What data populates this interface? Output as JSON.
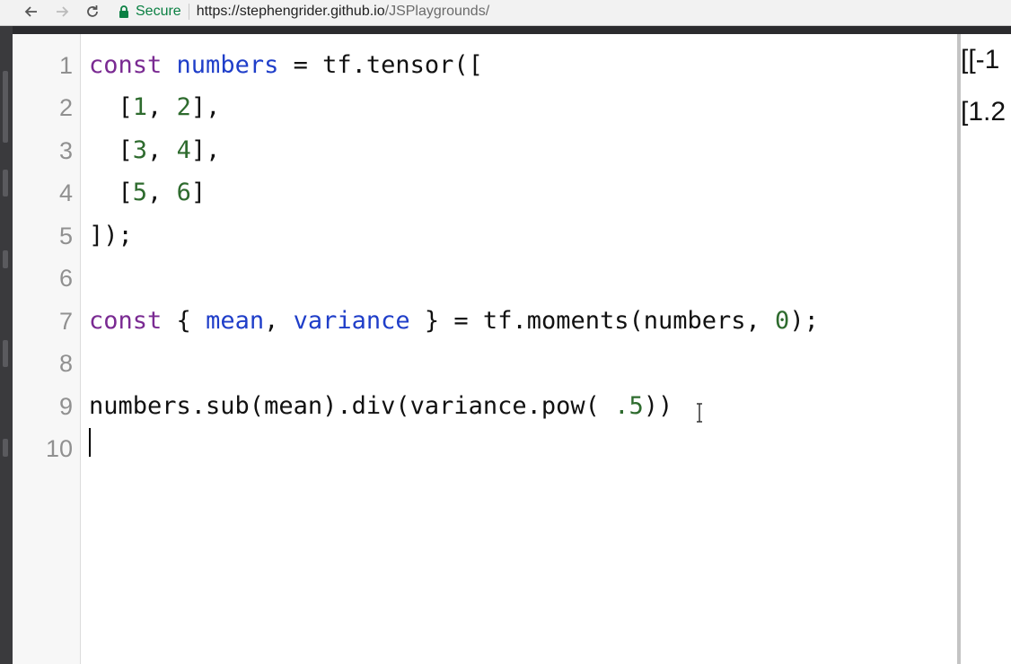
{
  "browser": {
    "back_icon": "back-arrow-icon",
    "forward_icon": "forward-arrow-icon",
    "reload_icon": "reload-icon",
    "lock_icon": "lock-icon",
    "secure_label": "Secure",
    "url_host": "https://stephengrider.github.io",
    "url_path": "/JSPlaygrounds/"
  },
  "editor": {
    "line_numbers": [
      "1",
      "2",
      "3",
      "4",
      "5",
      "6",
      "7",
      "8",
      "9",
      "10"
    ],
    "lines": [
      {
        "t1": "const",
        "t2": " ",
        "t3": "numbers",
        "t4": " = tf.tensor(["
      },
      {
        "a": "  [",
        "b": "1",
        "c": ", ",
        "d": "2",
        "e": "],"
      },
      {
        "a": "  [",
        "b": "3",
        "c": ", ",
        "d": "4",
        "e": "],"
      },
      {
        "a": "  [",
        "b": "5",
        "c": ", ",
        "d": "6",
        "e": "]"
      },
      {
        "text": "]);"
      },
      {
        "text": ""
      },
      {
        "t1": "const",
        "t2": " { ",
        "t3": "mean",
        "t4": ", ",
        "t5": "variance",
        "t6": " } = tf.moments(numbers, ",
        "t7": "0",
        "t8": ");"
      },
      {
        "text": ""
      },
      {
        "a": "numbers.sub(mean).div(variance.pow( ",
        "b": ".5",
        "c": "))"
      },
      {
        "text": ""
      }
    ]
  },
  "output": {
    "line1": "[[-1",
    "line2": "[1.2"
  }
}
